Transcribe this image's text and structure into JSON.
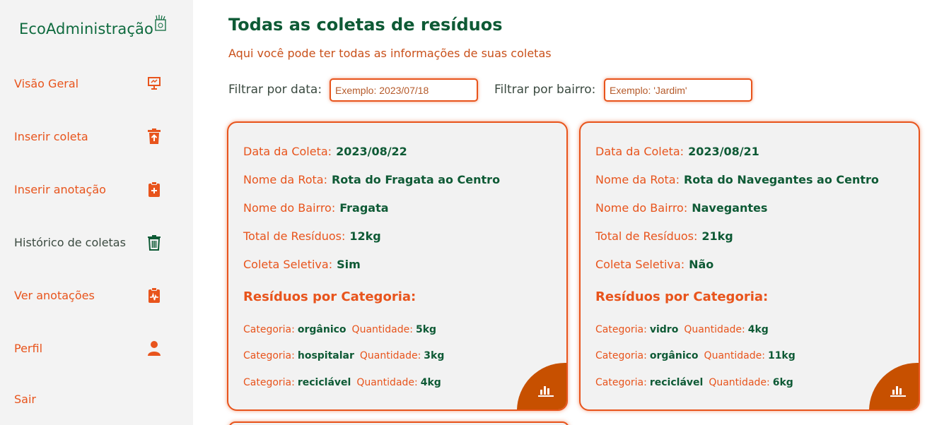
{
  "sidebar": {
    "logo": "EcoAdministração",
    "items": [
      {
        "label": "Visão Geral",
        "icon": "presentation-icon"
      },
      {
        "label": "Inserir coleta",
        "icon": "trash-upload-icon"
      },
      {
        "label": "Inserir anotação",
        "icon": "clipboard-plus-icon"
      },
      {
        "label": "Histórico de coletas",
        "icon": "trash-can-icon"
      },
      {
        "label": "Ver anotações",
        "icon": "clipboard-pulse-icon"
      },
      {
        "label": "Perfil",
        "icon": "user-icon"
      },
      {
        "label": "Sair",
        "icon": ""
      }
    ]
  },
  "header": {
    "title": "Todas as coletas de resíduos",
    "subtitle": "Aqui você pode ter todas as informações de suas coletas"
  },
  "filters": {
    "date_label": "Filtrar por data:",
    "date_placeholder": "Exemplo: 2023/07/18",
    "bairro_label": "Filtrar por bairro:",
    "bairro_placeholder": "Exemplo: 'Jardim'"
  },
  "labels": {
    "data": "Data da Coleta:",
    "rota": "Nome da Rota:",
    "bairro": "Nome do Bairro:",
    "total": "Total de Resíduos:",
    "seletiva": "Coleta Seletiva:",
    "categorias_title": "Resíduos por Categoria:",
    "categoria": "Categoria:",
    "quantidade": "Quantidade:"
  },
  "cards": [
    {
      "data": "2023/08/22",
      "rota": "Rota do Fragata ao Centro",
      "bairro": "Fragata",
      "total": "12kg",
      "seletiva": "Sim",
      "categorias": [
        {
          "categoria": "orgânico",
          "quantidade": "5kg"
        },
        {
          "categoria": "hospitalar",
          "quantidade": "3kg"
        },
        {
          "categoria": "reciclável",
          "quantidade": "4kg"
        }
      ]
    },
    {
      "data": "2023/08/21",
      "rota": "Rota do Navegantes ao Centro",
      "bairro": "Navegantes",
      "total": "21kg",
      "seletiva": "Não",
      "categorias": [
        {
          "categoria": "vidro",
          "quantidade": "4kg"
        },
        {
          "categoria": "orgânico",
          "quantidade": "11kg"
        },
        {
          "categoria": "reciclável",
          "quantidade": "6kg"
        }
      ]
    }
  ],
  "colors": {
    "accent": "#e8541c",
    "brand_green": "#0e5a35",
    "chart_button": "#c75000"
  }
}
